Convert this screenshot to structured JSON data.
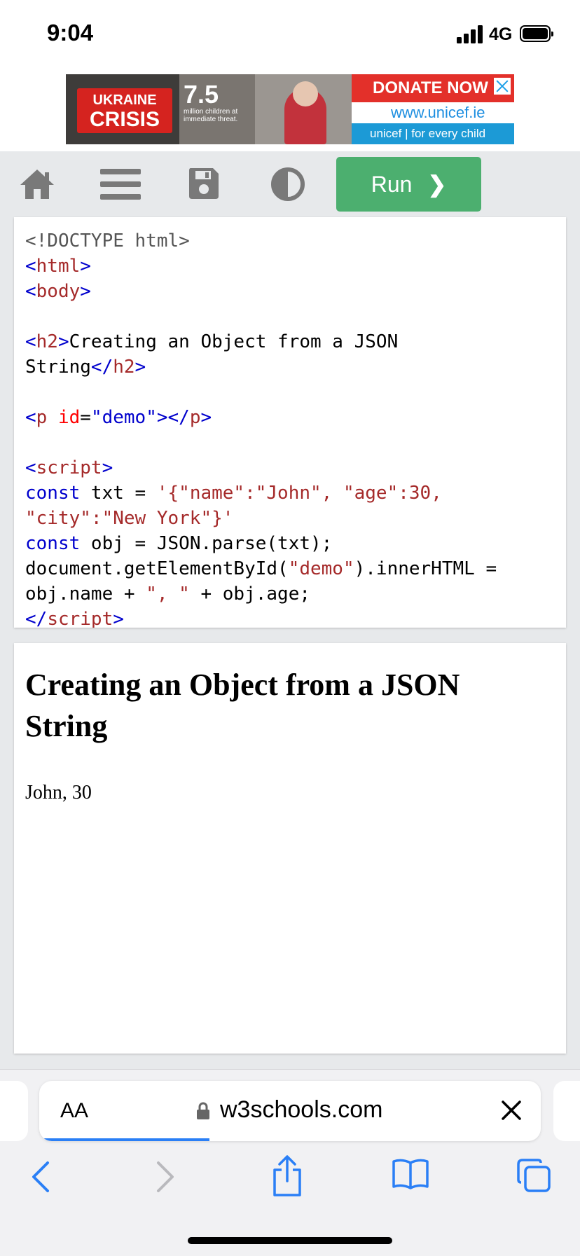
{
  "status_bar": {
    "time": "9:04",
    "network": "4G"
  },
  "ad": {
    "brand_line1": "UKRAINE",
    "brand_line2": "CRISIS",
    "stat_number": "7.5",
    "stat_text": "million children at immediate threat.",
    "cta": "DONATE NOW",
    "url": "www.unicef.ie",
    "tagline": "unicef | for every child"
  },
  "toolbar": {
    "icons": [
      "home-icon",
      "menu-icon",
      "save-icon",
      "theme-toggle-icon"
    ],
    "run_label": "Run",
    "run_chevron": "❯",
    "run_color": "#4caf6f"
  },
  "code": {
    "doctype": "<!DOCTYPE html>",
    "html_tag": "html",
    "body_tag": "body",
    "h2_tag": "h2",
    "h2_text_line1": "Creating an Object from a JSON",
    "h2_text_line2": "String",
    "p_tag": "p",
    "p_attr": "id",
    "p_attr_value": "\"demo\"",
    "script_tag": "script",
    "kw_const": "const",
    "line_txt_start": " txt = ",
    "line_txt_str1": "'{\"name\":\"John\", \"age\":30,",
    "line_txt_str2": "\"city\":\"New York\"}'",
    "line_obj": " obj = JSON.parse(txt);",
    "line_doc_start": "document.getElementById(",
    "line_doc_str": "\"demo\"",
    "line_doc_end": ").innerHTML =",
    "line_name_start": "obj.name + ",
    "line_name_str": "\", \"",
    "line_name_end": " + obj.age;"
  },
  "result": {
    "heading": "Creating an Object from a JSON String",
    "paragraph": "John, 30"
  },
  "safari": {
    "text_size_label": "AA",
    "domain": "w3schools.com",
    "nav_icons": [
      "back-icon",
      "forward-icon",
      "share-icon",
      "bookmarks-icon",
      "tabs-icon"
    ],
    "load_progress": 0.34
  }
}
